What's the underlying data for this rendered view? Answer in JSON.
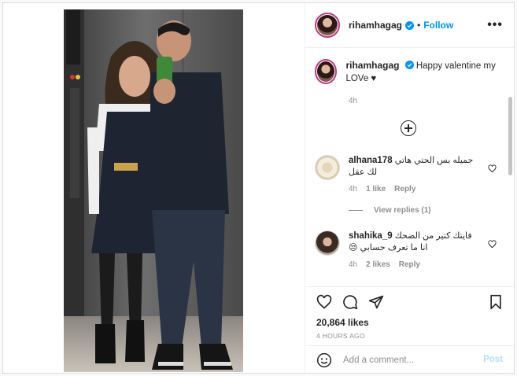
{
  "post": {
    "author": "rihamhagag",
    "follow_label": "Follow",
    "separator": "•",
    "more_label": "•••",
    "caption": "Happy valentine my LOVe",
    "caption_heart": "♥",
    "caption_time": "4h"
  },
  "comments": [
    {
      "user": "alhana178",
      "text": "جميله بس الحتي هاتي لك عقل",
      "time": "4h",
      "likes": "1 like",
      "reply_label": "Reply",
      "view_replies": "View replies (1)"
    },
    {
      "user": "shahika_9",
      "text": "فايتك كتير من الضحك انا ما تعرف حسابي 😒",
      "time": "4h",
      "likes": "2 likes",
      "reply_label": "Reply"
    }
  ],
  "stats": {
    "likes": "20,864 likes",
    "posted_ago": "4 HOURS AGO"
  },
  "composer": {
    "placeholder": "Add a comment...",
    "post_label": "Post"
  },
  "colors": {
    "accent": "#0095f6",
    "post_disabled": "#b2dffc",
    "muted": "#8e8e8e",
    "border": "#dbdbdb"
  },
  "icons": {
    "verified": "verified-badge-icon",
    "like": "heart-icon",
    "comment": "comment-bubble-icon",
    "share": "paper-plane-icon",
    "save": "bookmark-icon",
    "emoji": "smiley-icon",
    "load_more": "plus-circle-icon"
  }
}
